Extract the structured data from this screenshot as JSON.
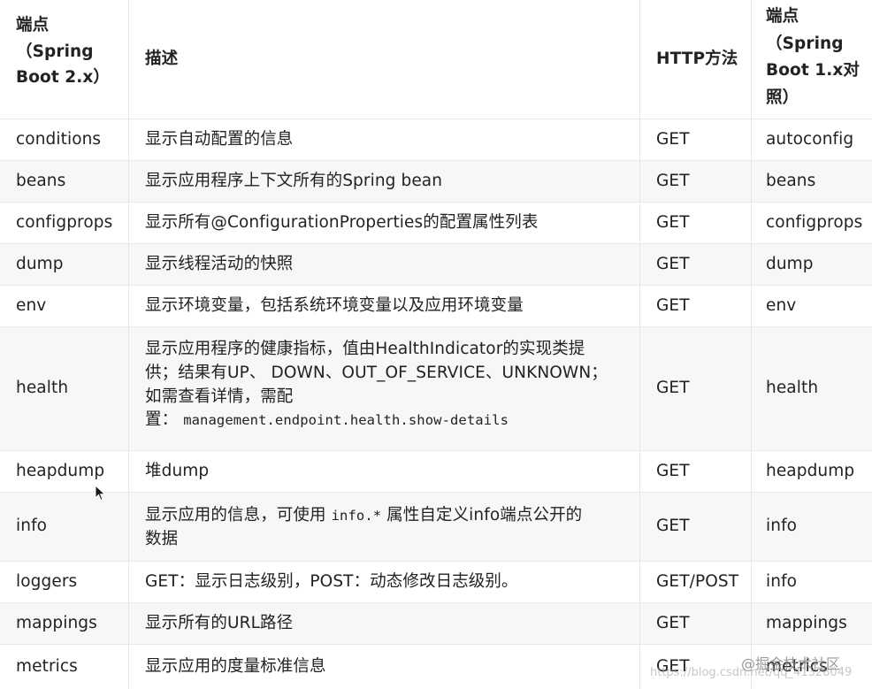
{
  "table": {
    "header": {
      "col1": [
        "端点",
        "（Spring",
        "Boot 2.x）"
      ],
      "col2": "描述",
      "col3": "HTTP方法",
      "col4": [
        "端点",
        "（Spring",
        "Boot 1.x对",
        "照）"
      ]
    },
    "rows": [
      {
        "endpoint": "conditions",
        "desc": "显示自动配置的信息",
        "method": "GET",
        "boot1": "autoconfig"
      },
      {
        "endpoint": "beans",
        "desc": "显示应用程序上下文所有的Spring bean",
        "method": "GET",
        "boot1": "beans"
      },
      {
        "endpoint": "configprops",
        "desc": "显示所有@ConfigurationProperties的配置属性列表",
        "method": "GET",
        "boot1": "configprops"
      },
      {
        "endpoint": "dump",
        "desc": "显示线程活动的快照",
        "method": "GET",
        "boot1": "dump"
      },
      {
        "endpoint": "env",
        "desc": "显示环境变量，包括系统环境变量以及应用环境变量",
        "method": "GET",
        "boot1": "env"
      },
      {
        "endpoint": "health",
        "desc_lines": [
          "显示应用程序的健康指标，值由HealthIndicator的实现类提",
          "供；结果有UP、 DOWN、OUT_OF_SERVICE、UNKNOWN；",
          "如需查看详情，需配"
        ],
        "desc_last_prefix": "置：",
        "desc_last_code": "management.endpoint.health.show-details",
        "method": "GET",
        "boot1": "health"
      },
      {
        "endpoint": "heapdump",
        "desc": "堆dump",
        "method": "GET",
        "boot1": "heapdump"
      },
      {
        "endpoint": "info",
        "desc_pre": "显示应用的信息，可使用 ",
        "desc_code": "info.*",
        "desc_post": " 属性自定义info端点公开的",
        "desc_line2": "数据",
        "method": "GET",
        "boot1": "info"
      },
      {
        "endpoint": "loggers",
        "desc": "GET：显示日志级别，POST：动态修改日志级别。",
        "method": "GET/POST",
        "boot1": "info"
      },
      {
        "endpoint": "mappings",
        "desc": "显示所有的URL路径",
        "method": "GET",
        "boot1": "mappings"
      },
      {
        "endpoint": "metrics",
        "desc": "显示应用的度量标准信息",
        "method": "GET",
        "boot1": "metrics"
      }
    ]
  },
  "watermark": {
    "community": "@掘金技术社区",
    "blog": "https://blog.csdn.net/qq_41328049"
  },
  "icons": {
    "cursor": "mouse-pointer-icon"
  },
  "colors": {
    "text": "#222222",
    "alt_row": "#f7f7f7",
    "border": "#e7e7e7"
  }
}
